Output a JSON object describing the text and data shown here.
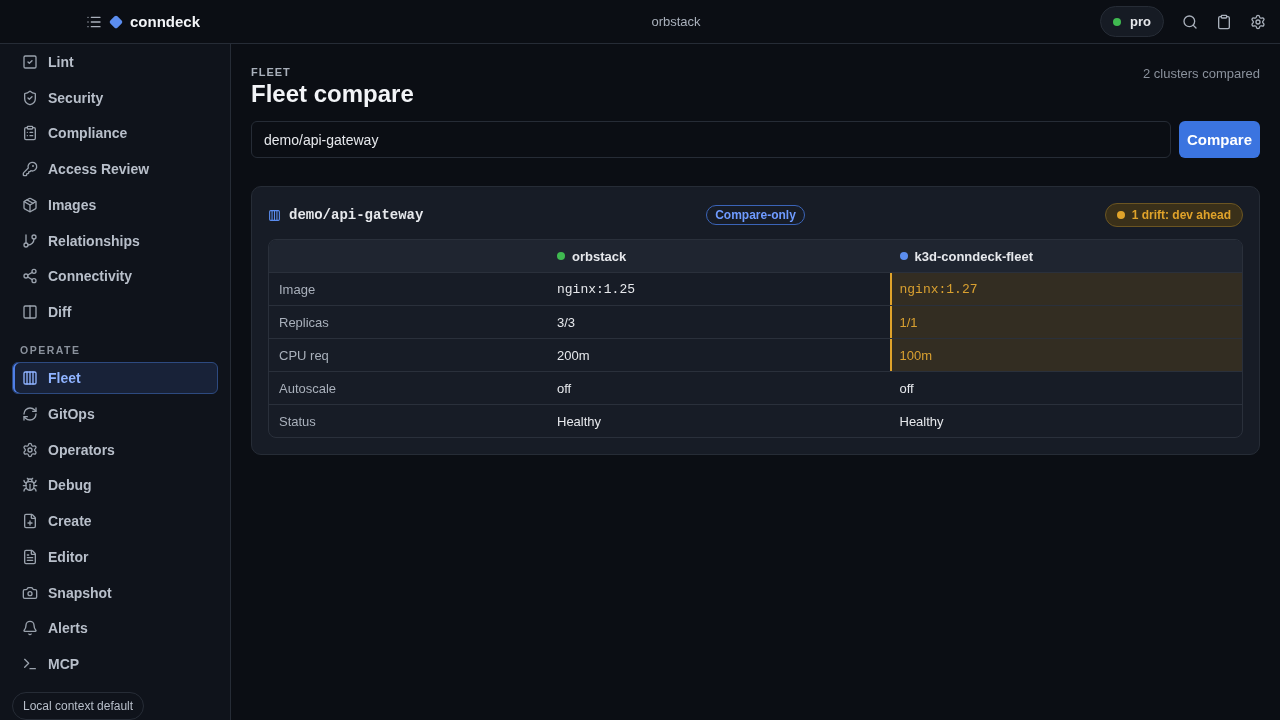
{
  "header": {
    "brand": "conndeck",
    "context": "orbstack",
    "plan": {
      "label": "pro",
      "color": "#3fb950"
    }
  },
  "sidebar": {
    "items": [
      {
        "label": "Lint",
        "selected": false
      },
      {
        "label": "Security",
        "selected": false
      },
      {
        "label": "Compliance",
        "selected": false
      },
      {
        "label": "Access Review",
        "selected": false
      },
      {
        "label": "Images",
        "selected": false
      },
      {
        "label": "Relationships",
        "selected": false
      },
      {
        "label": "Connectivity",
        "selected": false
      },
      {
        "label": "Diff",
        "selected": false
      }
    ],
    "section": "OPERATE",
    "operate_items": [
      {
        "label": "Fleet",
        "selected": true
      },
      {
        "label": "GitOps",
        "selected": false
      },
      {
        "label": "Operators",
        "selected": false
      },
      {
        "label": "Debug",
        "selected": false
      },
      {
        "label": "Create",
        "selected": false
      },
      {
        "label": "Editor",
        "selected": false
      },
      {
        "label": "Snapshot",
        "selected": false
      },
      {
        "label": "Alerts",
        "selected": false
      },
      {
        "label": "MCP",
        "selected": false
      }
    ],
    "footer": "Local context default"
  },
  "page": {
    "eyebrow": "FLEET",
    "title": "Fleet compare",
    "summary": "2 clusters compared",
    "query": {
      "value": "demo/api-gateway"
    },
    "button": "Compare"
  },
  "card": {
    "title": "demo/api-gateway",
    "mode": "Compare-only",
    "drift": "1 drift: dev ahead",
    "columns": [
      {
        "name": "orbstack",
        "color": "#3fb950"
      },
      {
        "name": "k3d-conndeck-fleet",
        "color": "#5b8def"
      }
    ],
    "rows": [
      {
        "label": "Image",
        "kind": "mono",
        "values": [
          {
            "text": "nginx:1.25",
            "drift": false
          },
          {
            "text": "nginx:1.27",
            "drift": true
          }
        ]
      },
      {
        "label": "Replicas",
        "kind": "text",
        "values": [
          {
            "text": "3/3",
            "drift": false
          },
          {
            "text": "1/1",
            "drift": true
          }
        ]
      },
      {
        "label": "CPU req",
        "kind": "text",
        "values": [
          {
            "text": "200m",
            "drift": false
          },
          {
            "text": "100m",
            "drift": true
          }
        ]
      },
      {
        "label": "Autoscale",
        "kind": "text",
        "values": [
          {
            "text": "off",
            "drift": false
          },
          {
            "text": "off",
            "drift": false
          }
        ]
      },
      {
        "label": "Status",
        "kind": "text",
        "values": [
          {
            "text": "Healthy",
            "drift": false
          },
          {
            "text": "Healthy",
            "drift": false
          }
        ]
      }
    ]
  }
}
